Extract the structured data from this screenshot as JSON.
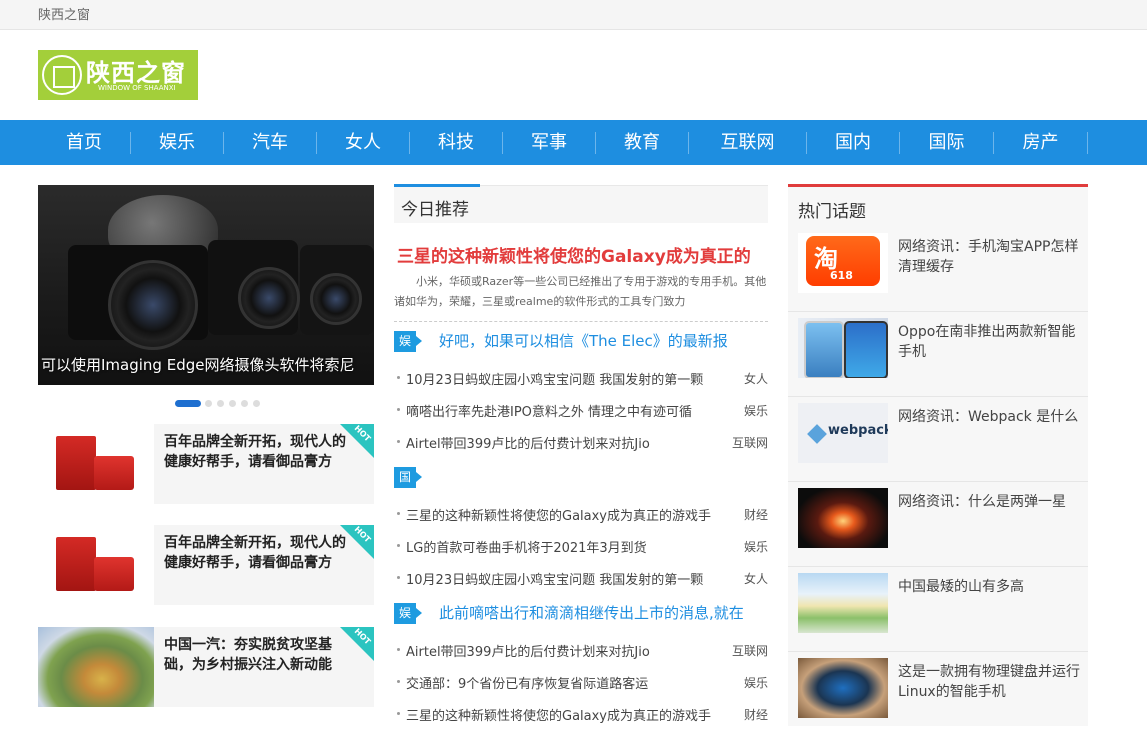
{
  "site": {
    "name": "陕西之窗"
  },
  "logo": {
    "name": "陕西之窗",
    "sub": "WINDOW OF SHAANXI"
  },
  "nav": [
    "首页",
    "娱乐",
    "汽车",
    "女人",
    "科技",
    "军事",
    "教育",
    "互联网",
    "国内",
    "国际",
    "房产"
  ],
  "slider": {
    "caption": "可以使用Imaging Edge网络摄像头软件将索尼",
    "dots": 6,
    "active": 0
  },
  "left_cards": [
    {
      "title": "百年品牌全新开拓，现代人的健康好帮手，请看御品膏方",
      "badge": "HOT"
    },
    {
      "title": "百年品牌全新开拓，现代人的健康好帮手，请看御品膏方",
      "badge": "HOT"
    },
    {
      "title": "中国一汽：夯实脱贫攻坚基础，为乡村振兴注入新动能",
      "badge": "HOT"
    }
  ],
  "today": {
    "title": "今日推荐",
    "headline": "三星的这种新颖性将使您的Galaxy成为真正的",
    "summary": "小米，华硕或Razer等一些公司已经推出了专用于游戏的专用手机。其他诸如华为，荣耀，三星或realme的软件形式的工具专门致力"
  },
  "sections": [
    {
      "tag": "娱乐",
      "title": "好吧，如果可以相信《The Elec》的最新报",
      "items": [
        {
          "text": "10月23日蚂蚁庄园小鸡宝宝问题 我国发射的第一颗",
          "cat": "女人"
        },
        {
          "text": "嘀嗒出行率先赴港IPO意料之外 情理之中有迹可循",
          "cat": "娱乐"
        },
        {
          "text": "Airtel带回399卢比的后付费计划来对抗Jio",
          "cat": "互联网"
        }
      ]
    },
    {
      "tag": "国内",
      "title": "",
      "items": [
        {
          "text": "三星的这种新颖性将使您的Galaxy成为真正的游戏手",
          "cat": "财经"
        },
        {
          "text": "LG的首款可卷曲手机将于2021年3月到货",
          "cat": "娱乐"
        },
        {
          "text": "10月23日蚂蚁庄园小鸡宝宝问题 我国发射的第一颗",
          "cat": "女人"
        }
      ]
    },
    {
      "tag": "娱乐",
      "title": "此前嘀嗒出行和滴滴相继传出上市的消息,就在",
      "items": [
        {
          "text": "Airtel带回399卢比的后付费计划来对抗Jio",
          "cat": "互联网"
        },
        {
          "text": "交通部：9个省份已有序恢复省际道路客运",
          "cat": "娱乐"
        },
        {
          "text": "三星的这种新颖性将使您的Galaxy成为真正的游戏手",
          "cat": "财经"
        }
      ]
    }
  ],
  "hot_topics": {
    "title": "热门话题",
    "items": [
      {
        "title": "网络资讯：手机淘宝APP怎样清理缓存",
        "icon": "taobao-618-image",
        "pic_text": "淘",
        "pic_sub": "618"
      },
      {
        "title": "Oppo在南非推出两款新智能手机",
        "icon": "oppo-phones-image"
      },
      {
        "title": "网络资讯：Webpack 是什么",
        "icon": "webpack-logo-image",
        "pic_text": "webpack"
      },
      {
        "title": "网络资讯：什么是两弹一星",
        "icon": "explosion-image"
      },
      {
        "title": "中国最矮的山有多高",
        "icon": "hill-landscape-image"
      },
      {
        "title": "这是一款拥有物理键盘并运行Linux的智能手机",
        "icon": "keyboard-phone-image"
      }
    ]
  },
  "colors": {
    "nav": "#1e8ee0",
    "headline": "#e23c3c",
    "hot_border": "#e03c3c",
    "badge": "#2bc4c0",
    "logo": "#a3cf3a"
  }
}
